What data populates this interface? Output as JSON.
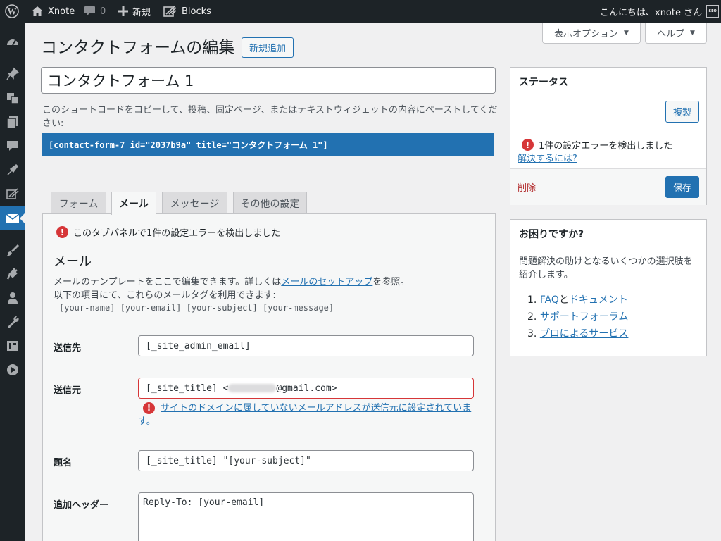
{
  "admin_bar": {
    "site_name": "Xnote",
    "comments_count": "0",
    "new_label": "新規",
    "blocks_label": "Blocks",
    "greeting": "こんにちは、xnote さん",
    "avatar_text": "SEO"
  },
  "sidebar": {
    "items": [
      "dashboard-icon",
      "pin-icon",
      "media-icon",
      "pages-icon",
      "comments-icon",
      "appearance-icon",
      "blocks-icon",
      "mail-icon",
      "brush-icon",
      "plugins-icon",
      "users-icon",
      "tools-icon",
      "settings-icon",
      "video-icon"
    ]
  },
  "screen_options": {
    "label": "表示オプション"
  },
  "help": {
    "label": "ヘルプ"
  },
  "header": {
    "title": "コンタクトフォームの編集",
    "add_new": "新規追加"
  },
  "form": {
    "title_value": "コンタクトフォーム 1",
    "shortcode_desc": "このショートコードをコピーして、投稿、固定ページ、またはテキストウィジェットの内容にペーストしてください:",
    "shortcode": "[contact-form-7 id=\"2037b9a\" title=\"コンタクトフォーム 1\"]"
  },
  "tabs": [
    "フォーム",
    "メール",
    "メッセージ",
    "その他の設定"
  ],
  "mail_panel": {
    "error_notice": "このタブパネルで1件の設定エラーを検出しました",
    "heading": "メール",
    "desc_before": "メールのテンプレートをここで編集できます。詳しくは",
    "desc_link": "メールのセットアップ",
    "desc_after": "を参照。",
    "desc_line2": "以下の項目にて、これらのメールタグを利用できます:",
    "mail_tags": "[your-name] [your-email] [your-subject] [your-message]",
    "fields": {
      "to_label": "送信先",
      "to_value": "[_site_admin_email]",
      "from_label": "送信元",
      "from_value_prefix": "[_site_title] <",
      "from_value_suffix": "@gmail.com>",
      "from_error_line1": "サイトのドメインに属していないメールアドレスが送信元に設定されていま",
      "from_error_line2": "す。",
      "subject_label": "題名",
      "subject_value": "[_site_title] \"[your-subject]\"",
      "headers_label": "追加ヘッダー",
      "headers_value": "Reply-To: [your-email]"
    }
  },
  "status_box": {
    "title": "ステータス",
    "duplicate": "複製",
    "error_text": "1件の設定エラーを検出しました",
    "resolve_link": "解決するには?",
    "delete": "削除",
    "save": "保存"
  },
  "help_box": {
    "title": "お困りですか?",
    "desc_line1": "問題解決の助けとなるいくつかの選択肢を",
    "desc_line2": "紹介します。",
    "items": [
      {
        "num": "1.",
        "link1": "FAQ",
        "sep": "と",
        "link2": "ドキュメント"
      },
      {
        "num": "2.",
        "link1": "サポートフォーラム"
      },
      {
        "num": "3.",
        "link1": "プロによるサービス"
      }
    ]
  },
  "colors": {
    "admin_bar": "#1d2327",
    "accent": "#2271b1",
    "error": "#d63638",
    "background": "#f0f0f1"
  }
}
